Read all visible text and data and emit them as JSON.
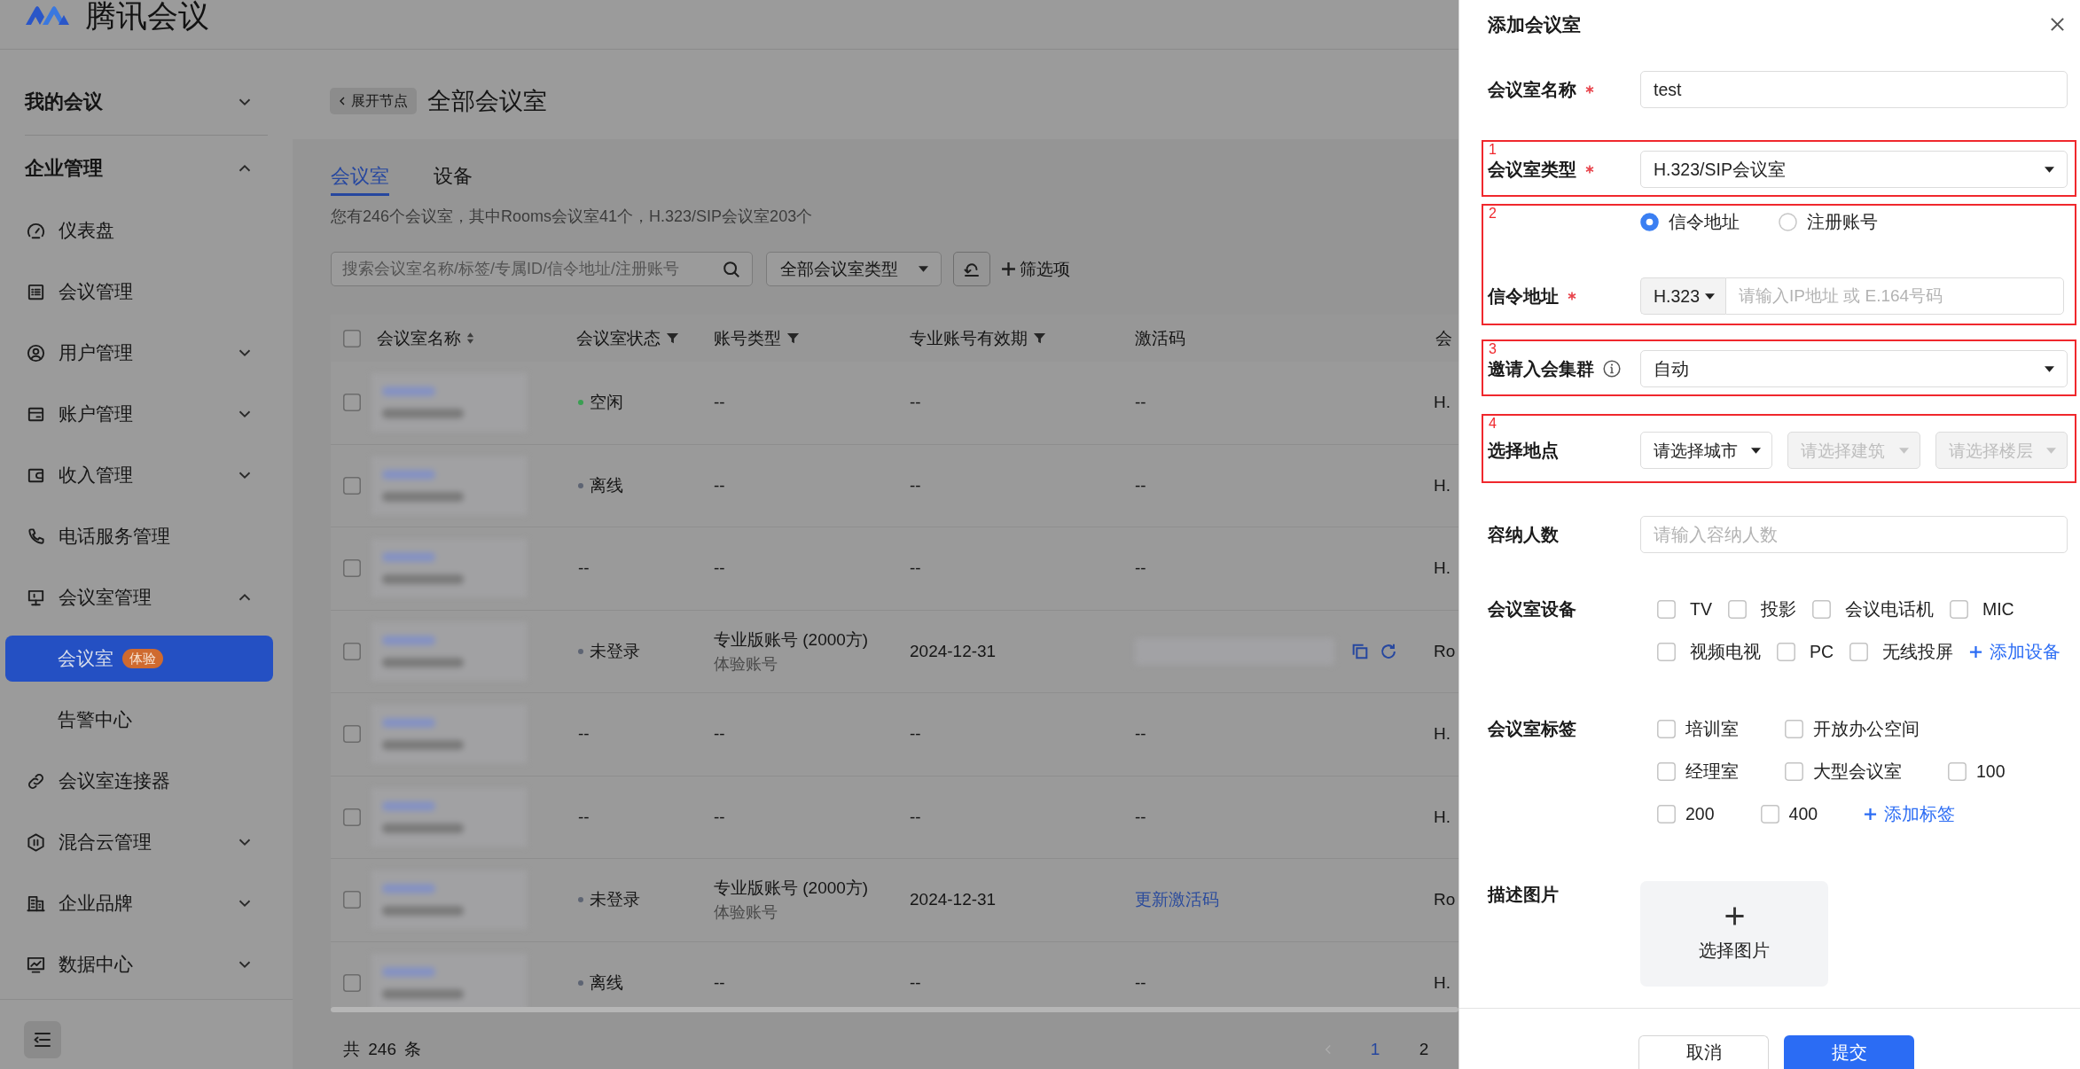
{
  "header": {
    "logo_text": "腾讯会议"
  },
  "sidebar": {
    "sections": [
      {
        "label": "我的会议",
        "expanded": false
      },
      {
        "label": "企业管理",
        "expanded": true,
        "items": [
          {
            "label": "仪表盘",
            "selected": false
          },
          {
            "label": "会议管理",
            "selected": false
          },
          {
            "label": "用户管理",
            "expanded": false
          },
          {
            "label": "账户管理",
            "expanded": false
          },
          {
            "label": "收入管理",
            "expanded": false
          },
          {
            "label": "电话服务管理",
            "selected": false
          },
          {
            "label": "会议室管理",
            "expanded": true,
            "children": [
              {
                "label": "会议室",
                "badge": "体验",
                "selected": true
              },
              {
                "label": "告警中心",
                "selected": false
              }
            ]
          },
          {
            "label": "会议室连接器",
            "selected": false
          },
          {
            "label": "混合云管理",
            "expanded": false
          },
          {
            "label": "企业品牌",
            "expanded": false
          },
          {
            "label": "数据中心",
            "expanded": false
          }
        ]
      }
    ]
  },
  "page_header": {
    "back_button": "展开节点",
    "title": "全部会议室"
  },
  "tabs": [
    {
      "label": "会议室",
      "selected": true
    },
    {
      "label": "设备",
      "selected": false
    }
  ],
  "summary": "您有246个会议室，其中Rooms会议室41个，H.323/SIP会议室203个",
  "toolbar": {
    "search": {
      "placeholder": "搜索会议室名称/标签/专属ID/信令地址/注册账号"
    },
    "type_filter": {
      "value": "全部会议室类型"
    },
    "filter_button": "筛选项"
  },
  "table": {
    "select_all": {
      "checked": false
    },
    "columns": [
      {
        "label": "会议室名称",
        "kind": "sort"
      },
      {
        "label": "会议室状态",
        "kind": "filter"
      },
      {
        "label": "账号类型",
        "kind": "filter"
      },
      {
        "label": "专业账号有效期",
        "kind": "filter"
      },
      {
        "label": "激活码",
        "kind": "plain"
      },
      {
        "label": "会",
        "kind": "plain"
      }
    ],
    "rows": [
      {
        "checked": false,
        "status": {
          "text": "空闲",
          "color": "#3a9f52"
        },
        "account": {
          "text": "--"
        },
        "expiry": "--",
        "code": {
          "kind": "text",
          "text": "--"
        },
        "column_6": "H."
      },
      {
        "checked": false,
        "status": {
          "text": "离线",
          "color": "#5d6473"
        },
        "account": {
          "text": "--"
        },
        "expiry": "--",
        "code": {
          "kind": "text",
          "text": "--"
        },
        "column_6": "H."
      },
      {
        "checked": false,
        "status": {
          "text": "--"
        },
        "account": {
          "text": "--"
        },
        "expiry": "--",
        "code": {
          "kind": "text",
          "text": "--"
        },
        "column_6": "H."
      },
      {
        "checked": false,
        "status": {
          "text": "未登录",
          "color": "#5d6473"
        },
        "account": {
          "text": "专业版账号 (2000方)",
          "note": "体验账号"
        },
        "expiry": "2024-12-31",
        "code": {
          "kind": "masked"
        },
        "column_6": "Ro"
      },
      {
        "checked": false,
        "status": {
          "text": "--"
        },
        "account": {
          "text": "--"
        },
        "expiry": "--",
        "code": {
          "kind": "text",
          "text": "--"
        },
        "column_6": "H."
      },
      {
        "checked": false,
        "status": {
          "text": "--"
        },
        "account": {
          "text": "--"
        },
        "expiry": "--",
        "code": {
          "kind": "text",
          "text": "--"
        },
        "column_6": "H."
      },
      {
        "checked": false,
        "status": {
          "text": "未登录",
          "color": "#5d6473"
        },
        "account": {
          "text": "专业版账号 (2000方)",
          "note": "体验账号"
        },
        "expiry": "2024-12-31",
        "code": {
          "kind": "link",
          "text": "更新激活码"
        },
        "column_6": "Ro"
      },
      {
        "checked": false,
        "status": {
          "text": "离线",
          "color": "#5d6473"
        },
        "account": {
          "text": "--"
        },
        "expiry": "--",
        "code": {
          "kind": "text",
          "text": "--"
        },
        "column_6": "H."
      }
    ]
  },
  "pagination": {
    "total": "共 246 条",
    "prev": {
      "disabled": true
    },
    "pages": [
      {
        "label": "1",
        "selected": true
      },
      {
        "label": "2",
        "selected": false
      }
    ]
  },
  "drawer": {
    "title": "添加会议室",
    "fields": [
      {
        "kind": "input",
        "label": "会议室名称",
        "required": true,
        "value": "test"
      },
      {
        "kind": "select",
        "label": "会议室类型",
        "required": true,
        "value": "H.323/SIP会议室",
        "annotation": "1"
      },
      {
        "kind": "address",
        "annotation": "2",
        "options": [
          {
            "label": "信令地址",
            "selected": true
          },
          {
            "label": "注册账号",
            "selected": false
          }
        ],
        "label": "信令地址",
        "required": true,
        "protocol": "H.323",
        "placeholder": "请输入IP地址 或 E.164号码"
      },
      {
        "kind": "select",
        "label": "邀请入会集群",
        "info": true,
        "value": "自动",
        "annotation": "3"
      },
      {
        "kind": "location",
        "label": "选择地点",
        "annotation": "4",
        "selects": [
          {
            "placeholder": "请选择城市",
            "disabled": false
          },
          {
            "placeholder": "请选择建筑",
            "disabled": true
          },
          {
            "placeholder": "请选择楼层",
            "disabled": true
          }
        ]
      },
      {
        "kind": "input",
        "label": "容纳人数",
        "placeholder": "请输入容纳人数"
      },
      {
        "kind": "checkboxes",
        "label": "会议室设备",
        "rows": [
          [
            {
              "label": "TV",
              "checked": false
            },
            {
              "label": "投影",
              "checked": false
            },
            {
              "label": "会议电话机",
              "checked": false
            },
            {
              "label": "MIC",
              "checked": false
            }
          ],
          [
            {
              "label": "视频电视",
              "checked": false
            },
            {
              "label": "PC",
              "checked": false
            },
            {
              "label": "无线投屏",
              "checked": false
            }
          ]
        ],
        "add_link": "添加设备"
      },
      {
        "kind": "checkboxes_wide",
        "label": "会议室标签",
        "rows": [
          [
            {
              "label": "培训室",
              "checked": false
            },
            {
              "label": "开放办公空间",
              "checked": false
            }
          ],
          [
            {
              "label": "经理室",
              "checked": false
            },
            {
              "label": "大型会议室",
              "checked": false
            },
            {
              "label": "100",
              "checked": false
            }
          ],
          [
            {
              "label": "200",
              "checked": false
            },
            {
              "label": "400",
              "checked": false
            }
          ]
        ],
        "add_link": "添加标签"
      },
      {
        "kind": "upload",
        "label": "描述图片",
        "button": "选择图片"
      }
    ],
    "buttons": [
      {
        "label": "取消",
        "kind": "secondary"
      },
      {
        "label": "提交",
        "kind": "primary"
      }
    ]
  }
}
